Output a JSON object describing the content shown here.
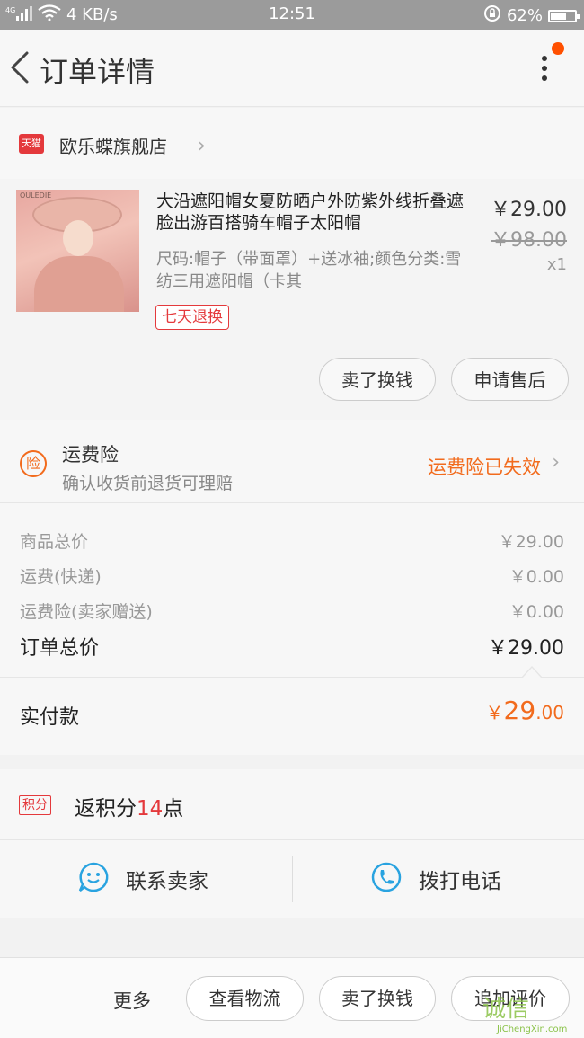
{
  "status_bar": {
    "network": "4G",
    "speed": "4 KB/s",
    "time": "12:51",
    "battery": "62%"
  },
  "header": {
    "title": "订单详情"
  },
  "shop": {
    "badge": "天猫",
    "name": "欧乐蝶旗舰店"
  },
  "product": {
    "image_brand": "OULEDIE",
    "title": "大沿遮阳帽女夏防晒户外防紫外线折叠遮脸出游百搭骑车帽子太阳帽",
    "spec": "尺码:帽子（带面罩）+送冰袖;颜色分类:雪纺三用遮阳帽（卡其",
    "price": "￥29.00",
    "original_price": "￥98.00",
    "quantity": "x1",
    "return_badge": "七天退换",
    "actions": [
      "卖了换钱",
      "申请售后"
    ]
  },
  "insurance": {
    "icon_text": "险",
    "title": "运费险",
    "subtitle": "确认收货前退货可理赔",
    "status": "运费险已失效"
  },
  "costs": [
    {
      "label": "商品总价",
      "value": "￥29.00"
    },
    {
      "label": "运费(快递)",
      "value": "￥0.00"
    },
    {
      "label": "运费险(卖家赠送)",
      "value": "￥0.00"
    }
  ],
  "order_total": {
    "label": "订单总价",
    "value": "￥29.00"
  },
  "paid": {
    "label": "实付款",
    "currency": "￥",
    "integer": "29",
    "decimal": ".00"
  },
  "points": {
    "badge": "积分",
    "prefix": "返积分",
    "amount": "14",
    "suffix": "点"
  },
  "contact": {
    "seller_label": "联系卖家",
    "phone_label": "拨打电话"
  },
  "bottom_bar": {
    "more": "更多",
    "buttons": [
      "查看物流",
      "卖了换钱",
      "追加评价"
    ]
  },
  "watermark": {
    "main": "诚信",
    "sub": "JiChengXin.com"
  },
  "colors": {
    "accent": "#f26b1d",
    "tmall_red": "#e4393c",
    "status_bar": "#9b9b9b",
    "icon_blue": "#29a3e0"
  }
}
